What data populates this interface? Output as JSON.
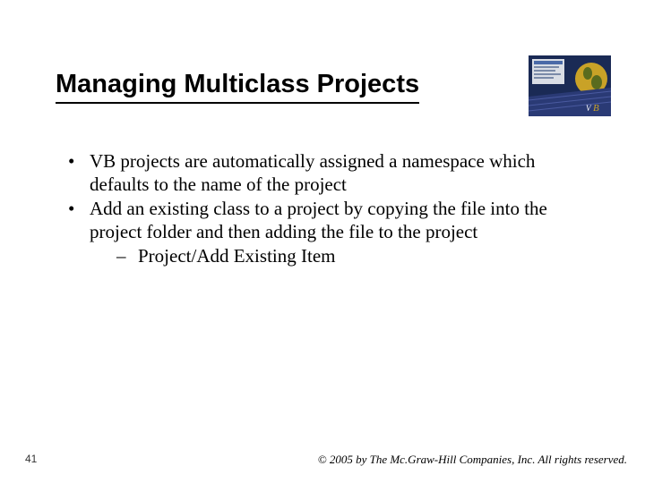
{
  "title": "Managing Multiclass Projects",
  "bullets": [
    {
      "text": "VB projects are automatically assigned a namespace which defaults to the name of the project"
    },
    {
      "text": "Add an existing class to a project by copying the file into the project folder and then adding the file to the project",
      "sub": [
        "Project/Add Existing Item"
      ]
    }
  ],
  "pageNumber": "41",
  "copyright": "© 2005 by The Mc.Graw-Hill Companies, Inc. All rights reserved."
}
